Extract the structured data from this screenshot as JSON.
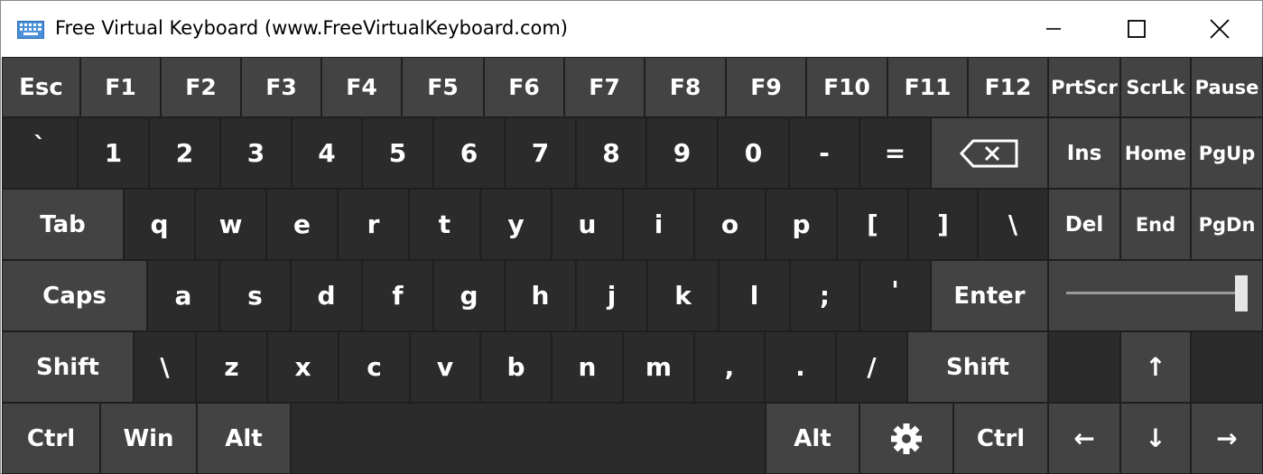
{
  "window": {
    "title": "Free Virtual Keyboard (www.FreeVirtualKeyboard.com)",
    "icon": "keyboard-icon",
    "controls": {
      "minimize": "minimize-icon",
      "maximize": "maximize-icon",
      "close": "close-icon"
    }
  },
  "keys": {
    "esc": "Esc",
    "f1": "F1",
    "f2": "F2",
    "f3": "F3",
    "f4": "F4",
    "f5": "F5",
    "f6": "F6",
    "f7": "F7",
    "f8": "F8",
    "f9": "F9",
    "f10": "F10",
    "f11": "F11",
    "f12": "F12",
    "prtscr": "PrtScr",
    "scrlk": "ScrLk",
    "pause": "Pause",
    "backtick": "`",
    "d1": "1",
    "d2": "2",
    "d3": "3",
    "d4": "4",
    "d5": "5",
    "d6": "6",
    "d7": "7",
    "d8": "8",
    "d9": "9",
    "d0": "0",
    "minus": "-",
    "equals": "=",
    "ins": "Ins",
    "home": "Home",
    "pgup": "PgUp",
    "tab": "Tab",
    "q": "q",
    "w": "w",
    "e": "e",
    "r": "r",
    "t": "t",
    "y": "y",
    "u": "u",
    "i": "i",
    "o": "o",
    "p": "p",
    "lbracket": "[",
    "rbracket": "]",
    "backslash": "\\",
    "del": "Del",
    "end": "End",
    "pgdn": "PgDn",
    "caps": "Caps",
    "a": "a",
    "s": "s",
    "d": "d",
    "f": "f",
    "g": "g",
    "h": "h",
    "j": "j",
    "k": "k",
    "l": "l",
    "semicolon": ";",
    "quote": "'",
    "enter": "Enter",
    "lshift": "Shift",
    "backslash2": "\\",
    "z": "z",
    "x": "x",
    "c": "c",
    "v": "v",
    "b": "b",
    "n": "n",
    "m": "m",
    "comma": ",",
    "period": ".",
    "slash": "/",
    "rshift": "Shift",
    "up": "↑",
    "lctrl": "Ctrl",
    "win": "Win",
    "lalt": "Alt",
    "space": "",
    "ralt": "Alt",
    "rctrl": "Ctrl",
    "left": "←",
    "down": "↓",
    "right": "→"
  },
  "icons": {
    "backspace": "backspace-icon",
    "settings": "gear-icon"
  },
  "slider": {
    "value": 1.0
  }
}
